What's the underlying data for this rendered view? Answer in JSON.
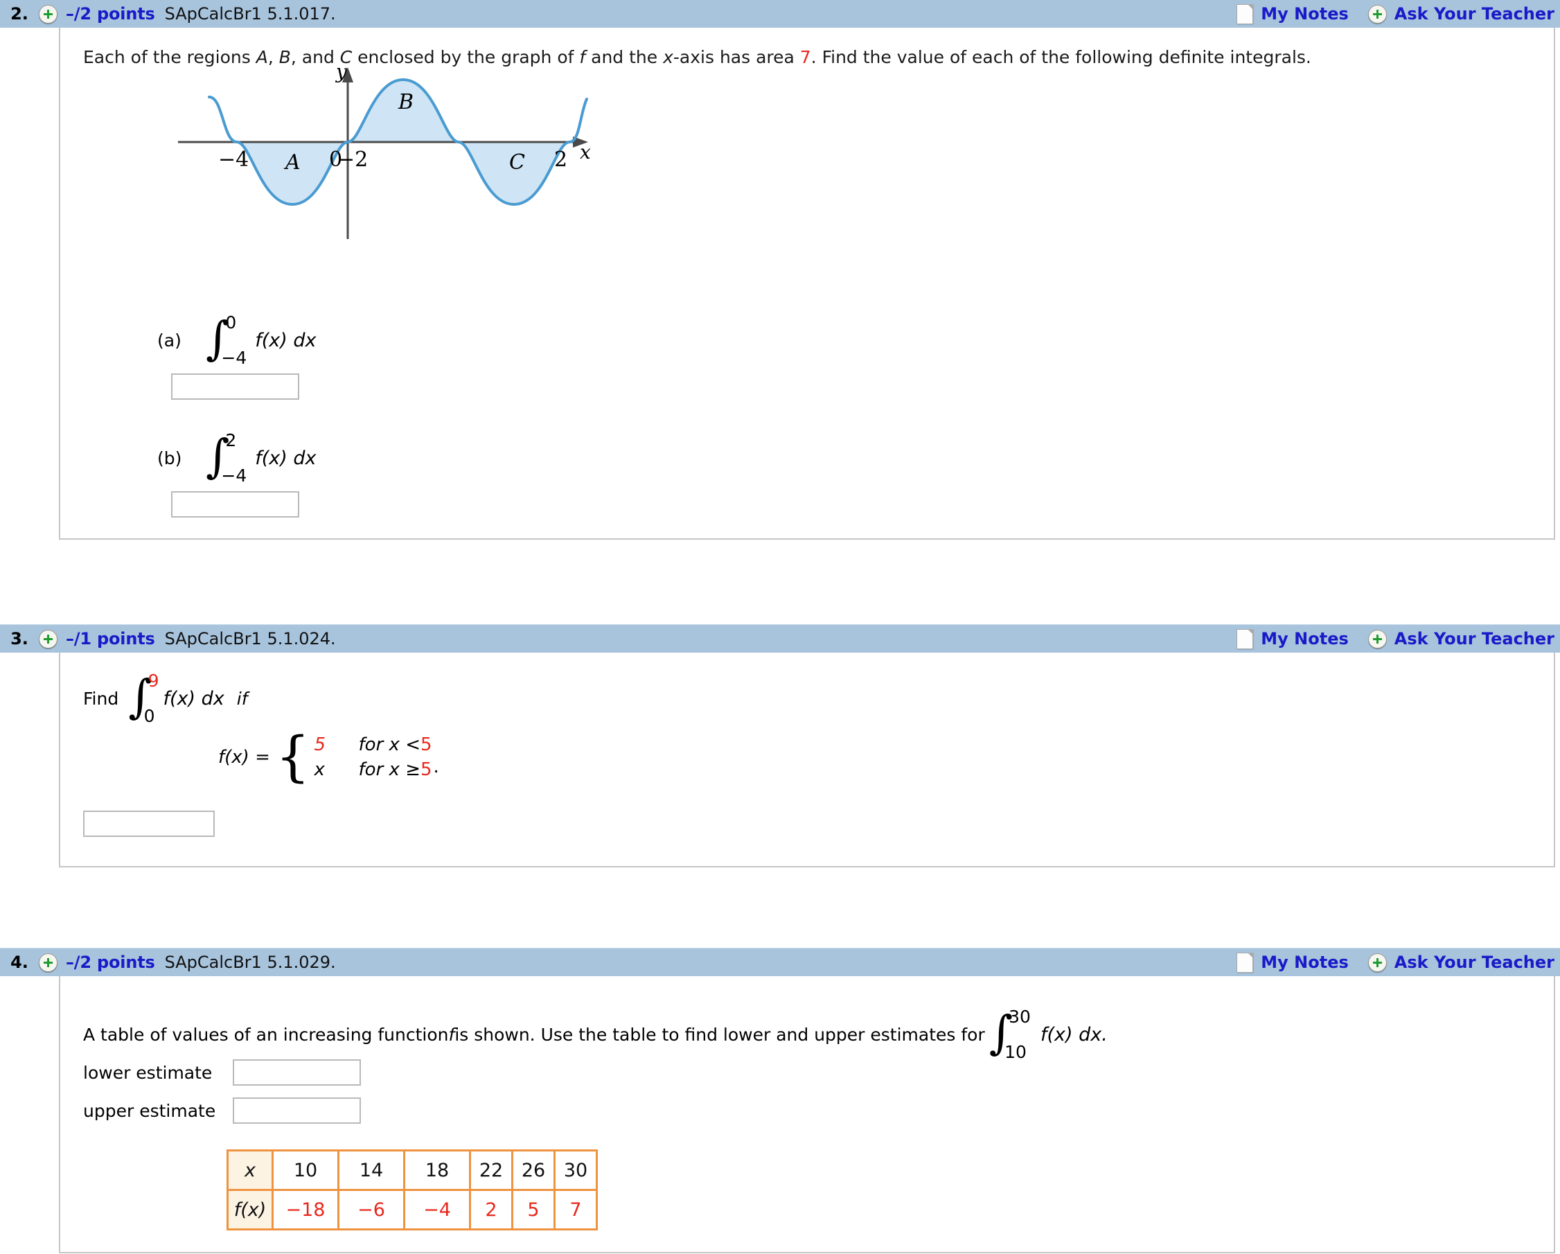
{
  "colors": {
    "header_bg": "#a8c4dd",
    "link_blue": "#1a1ac8",
    "accent_red": "#e8281e",
    "table_border": "#ef9340",
    "curve_blue": "#4a9bd1",
    "fill_blue": "#cfe5f5"
  },
  "questions": [
    {
      "number": "2.",
      "points": "–/2 points",
      "code": "SApCalcBr1 5.1.017.",
      "my_notes": "My Notes",
      "ask_teacher": "Ask Your Teacher",
      "prompt": {
        "p1": "Each of the regions ",
        "a": "A",
        "p2": ", ",
        "b": "B",
        "p3": ", and ",
        "c": "C",
        "p4": " enclosed by the graph of ",
        "f": "f",
        "p5": " and the ",
        "x": "x",
        "p6": "-axis has area ",
        "area": "7",
        "p7": ". Find the value of each of the following definite integrals."
      },
      "graph": {
        "ylabel": "y",
        "xlabel": "x",
        "tick_m4": "−4",
        "tick_m2": "−2",
        "tick_0": "0",
        "tick_2": "2",
        "region_a": "A",
        "region_b": "B",
        "region_c": "C"
      },
      "parts": [
        {
          "label": "(a)",
          "upper": "0",
          "lower": "−4",
          "integrand": "f(x) dx",
          "answer": ""
        },
        {
          "label": "(b)",
          "upper": "2",
          "lower": "−4",
          "integrand": "f(x) dx",
          "answer": ""
        }
      ]
    },
    {
      "number": "3.",
      "points": "–/1 points",
      "code": "SApCalcBr1 5.1.024.",
      "my_notes": "My Notes",
      "ask_teacher": "Ask Your Teacher",
      "find_label": "Find",
      "integral": {
        "upper": "9",
        "lower": "0",
        "integrand": "f(x) dx"
      },
      "if_label": "if",
      "piecewise": {
        "lhs": "f(x) =",
        "row1_value": "5",
        "row1_cond_pre": "for x < ",
        "row1_cond_val": "5",
        "row2_value": "x",
        "row2_cond_pre": "for x ≥ ",
        "row2_cond_val": "5",
        "period": "."
      },
      "answer": ""
    },
    {
      "number": "4.",
      "points": "–/2 points",
      "code": "SApCalcBr1 5.1.029.",
      "my_notes": "My Notes",
      "ask_teacher": "Ask Your Teacher",
      "prompt": {
        "p1": "A table of values of an increasing function ",
        "f": "f",
        "p2": " is shown. Use the table to find lower and upper estimates for "
      },
      "integral": {
        "upper": "30",
        "lower": "10",
        "integrand": "f(x) dx."
      },
      "lower_estimate_label": "lower estimate",
      "upper_estimate_label": "upper estimate",
      "lower_estimate_value": "",
      "upper_estimate_value": "",
      "table": {
        "row_header_x": "x",
        "row_header_fx": "f(x)",
        "x_values": [
          "10",
          "14",
          "18",
          "22",
          "26",
          "30"
        ],
        "f_values": [
          "−18",
          "−6",
          "−4",
          "2",
          "5",
          "7"
        ]
      }
    }
  ],
  "chart_data": {
    "type": "line",
    "title": "",
    "xlabel": "x",
    "ylabel": "y",
    "xlim": [
      -5,
      3
    ],
    "ylim": [
      -1.4,
      1.4
    ],
    "tick_labels_x": [
      "−4",
      "−2",
      "0",
      "2"
    ],
    "grid": false,
    "legend": null,
    "annotations": [
      {
        "text": "A",
        "x": -3,
        "y": -0.45,
        "note": "region below axis from -4 to -2, area 7"
      },
      {
        "text": "B",
        "x": -0.9,
        "y": 0.55,
        "note": "region above axis from -2 to 0, area 7"
      },
      {
        "text": "C",
        "x": 1.05,
        "y": -0.45,
        "note": "region below axis from 0 to 2, area 7"
      }
    ],
    "series": [
      {
        "name": "f",
        "description": "sinusoid f(x) = sin(pi*x/2) scaled, zeros at -4, -2, 0, 2",
        "x": [
          -4.6,
          -4,
          -3,
          -2,
          -1,
          0,
          1,
          2,
          2.6
        ],
        "y": [
          0.8,
          0,
          -1,
          0,
          1,
          0,
          -1,
          0,
          0.8
        ]
      }
    ]
  }
}
